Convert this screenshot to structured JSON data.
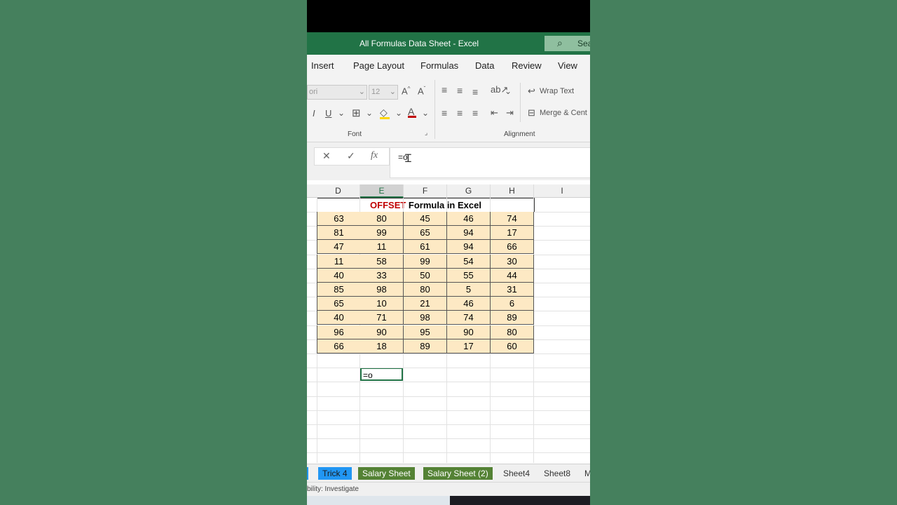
{
  "window": {
    "title": "All Formulas Data Sheet  -  Excel",
    "search_placeholder": "Sea"
  },
  "ribbon_tabs": [
    "Insert",
    "Page Layout",
    "Formulas",
    "Data",
    "Review",
    "View"
  ],
  "ribbon": {
    "font_name": "ori",
    "font_size": "12",
    "wrap_text": "Wrap Text",
    "merge_center": "Merge & Cent",
    "font_group": "Font",
    "alignment_group": "Alignment"
  },
  "formula_bar": {
    "value": "=o",
    "fx": "fx"
  },
  "columns": [
    "D",
    "E",
    "F",
    "G",
    "H",
    "I"
  ],
  "active_column": "E",
  "sheet": {
    "title_red": "OFFSET",
    "title_rest": " Formula in Excel",
    "rows": [
      [
        63,
        80,
        45,
        46,
        74
      ],
      [
        81,
        99,
        65,
        94,
        17
      ],
      [
        47,
        11,
        61,
        94,
        66
      ],
      [
        11,
        58,
        99,
        54,
        30
      ],
      [
        40,
        33,
        50,
        55,
        44
      ],
      [
        85,
        98,
        80,
        5,
        31
      ],
      [
        65,
        10,
        21,
        46,
        6
      ],
      [
        40,
        71,
        98,
        74,
        89
      ],
      [
        96,
        90,
        95,
        90,
        80
      ],
      [
        66,
        18,
        89,
        17,
        60
      ]
    ],
    "active_cell_value": "=o"
  },
  "sheet_tabs": [
    {
      "label": "Trick 4",
      "style": "blue"
    },
    {
      "label": "Salary Sheet",
      "style": "green"
    },
    {
      "label": "Salary Sheet (2)",
      "style": "green"
    },
    {
      "label": "Sheet4",
      "style": "plain"
    },
    {
      "label": "Sheet8",
      "style": "plain"
    },
    {
      "label": "M",
      "style": "plain"
    }
  ],
  "status": {
    "text": "bility: Investigate"
  },
  "colors": {
    "excel_green": "#217346",
    "cell_fill": "#fde9c4",
    "title_red": "#c00000"
  }
}
